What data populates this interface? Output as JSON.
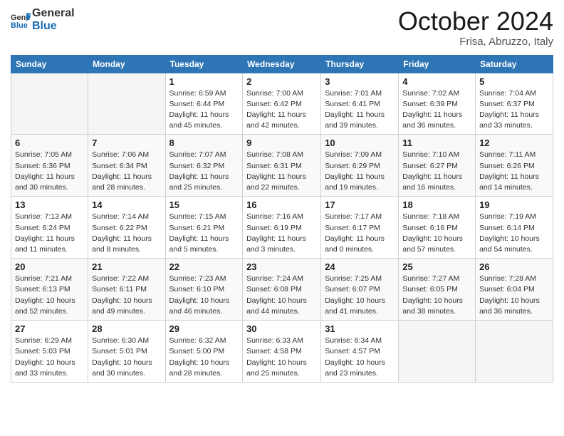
{
  "header": {
    "logo_general": "General",
    "logo_blue": "Blue",
    "month_title": "October 2024",
    "location": "Frisa, Abruzzo, Italy"
  },
  "weekdays": [
    "Sunday",
    "Monday",
    "Tuesday",
    "Wednesday",
    "Thursday",
    "Friday",
    "Saturday"
  ],
  "weeks": [
    [
      {
        "day": "",
        "sunrise": "",
        "sunset": "",
        "daylight": ""
      },
      {
        "day": "",
        "sunrise": "",
        "sunset": "",
        "daylight": ""
      },
      {
        "day": "1",
        "sunrise": "Sunrise: 6:59 AM",
        "sunset": "Sunset: 6:44 PM",
        "daylight": "Daylight: 11 hours and 45 minutes."
      },
      {
        "day": "2",
        "sunrise": "Sunrise: 7:00 AM",
        "sunset": "Sunset: 6:42 PM",
        "daylight": "Daylight: 11 hours and 42 minutes."
      },
      {
        "day": "3",
        "sunrise": "Sunrise: 7:01 AM",
        "sunset": "Sunset: 6:41 PM",
        "daylight": "Daylight: 11 hours and 39 minutes."
      },
      {
        "day": "4",
        "sunrise": "Sunrise: 7:02 AM",
        "sunset": "Sunset: 6:39 PM",
        "daylight": "Daylight: 11 hours and 36 minutes."
      },
      {
        "day": "5",
        "sunrise": "Sunrise: 7:04 AM",
        "sunset": "Sunset: 6:37 PM",
        "daylight": "Daylight: 11 hours and 33 minutes."
      }
    ],
    [
      {
        "day": "6",
        "sunrise": "Sunrise: 7:05 AM",
        "sunset": "Sunset: 6:36 PM",
        "daylight": "Daylight: 11 hours and 30 minutes."
      },
      {
        "day": "7",
        "sunrise": "Sunrise: 7:06 AM",
        "sunset": "Sunset: 6:34 PM",
        "daylight": "Daylight: 11 hours and 28 minutes."
      },
      {
        "day": "8",
        "sunrise": "Sunrise: 7:07 AM",
        "sunset": "Sunset: 6:32 PM",
        "daylight": "Daylight: 11 hours and 25 minutes."
      },
      {
        "day": "9",
        "sunrise": "Sunrise: 7:08 AM",
        "sunset": "Sunset: 6:31 PM",
        "daylight": "Daylight: 11 hours and 22 minutes."
      },
      {
        "day": "10",
        "sunrise": "Sunrise: 7:09 AM",
        "sunset": "Sunset: 6:29 PM",
        "daylight": "Daylight: 11 hours and 19 minutes."
      },
      {
        "day": "11",
        "sunrise": "Sunrise: 7:10 AM",
        "sunset": "Sunset: 6:27 PM",
        "daylight": "Daylight: 11 hours and 16 minutes."
      },
      {
        "day": "12",
        "sunrise": "Sunrise: 7:11 AM",
        "sunset": "Sunset: 6:26 PM",
        "daylight": "Daylight: 11 hours and 14 minutes."
      }
    ],
    [
      {
        "day": "13",
        "sunrise": "Sunrise: 7:13 AM",
        "sunset": "Sunset: 6:24 PM",
        "daylight": "Daylight: 11 hours and 11 minutes."
      },
      {
        "day": "14",
        "sunrise": "Sunrise: 7:14 AM",
        "sunset": "Sunset: 6:22 PM",
        "daylight": "Daylight: 11 hours and 8 minutes."
      },
      {
        "day": "15",
        "sunrise": "Sunrise: 7:15 AM",
        "sunset": "Sunset: 6:21 PM",
        "daylight": "Daylight: 11 hours and 5 minutes."
      },
      {
        "day": "16",
        "sunrise": "Sunrise: 7:16 AM",
        "sunset": "Sunset: 6:19 PM",
        "daylight": "Daylight: 11 hours and 3 minutes."
      },
      {
        "day": "17",
        "sunrise": "Sunrise: 7:17 AM",
        "sunset": "Sunset: 6:17 PM",
        "daylight": "Daylight: 11 hours and 0 minutes."
      },
      {
        "day": "18",
        "sunrise": "Sunrise: 7:18 AM",
        "sunset": "Sunset: 6:16 PM",
        "daylight": "Daylight: 10 hours and 57 minutes."
      },
      {
        "day": "19",
        "sunrise": "Sunrise: 7:19 AM",
        "sunset": "Sunset: 6:14 PM",
        "daylight": "Daylight: 10 hours and 54 minutes."
      }
    ],
    [
      {
        "day": "20",
        "sunrise": "Sunrise: 7:21 AM",
        "sunset": "Sunset: 6:13 PM",
        "daylight": "Daylight: 10 hours and 52 minutes."
      },
      {
        "day": "21",
        "sunrise": "Sunrise: 7:22 AM",
        "sunset": "Sunset: 6:11 PM",
        "daylight": "Daylight: 10 hours and 49 minutes."
      },
      {
        "day": "22",
        "sunrise": "Sunrise: 7:23 AM",
        "sunset": "Sunset: 6:10 PM",
        "daylight": "Daylight: 10 hours and 46 minutes."
      },
      {
        "day": "23",
        "sunrise": "Sunrise: 7:24 AM",
        "sunset": "Sunset: 6:08 PM",
        "daylight": "Daylight: 10 hours and 44 minutes."
      },
      {
        "day": "24",
        "sunrise": "Sunrise: 7:25 AM",
        "sunset": "Sunset: 6:07 PM",
        "daylight": "Daylight: 10 hours and 41 minutes."
      },
      {
        "day": "25",
        "sunrise": "Sunrise: 7:27 AM",
        "sunset": "Sunset: 6:05 PM",
        "daylight": "Daylight: 10 hours and 38 minutes."
      },
      {
        "day": "26",
        "sunrise": "Sunrise: 7:28 AM",
        "sunset": "Sunset: 6:04 PM",
        "daylight": "Daylight: 10 hours and 36 minutes."
      }
    ],
    [
      {
        "day": "27",
        "sunrise": "Sunrise: 6:29 AM",
        "sunset": "Sunset: 5:03 PM",
        "daylight": "Daylight: 10 hours and 33 minutes."
      },
      {
        "day": "28",
        "sunrise": "Sunrise: 6:30 AM",
        "sunset": "Sunset: 5:01 PM",
        "daylight": "Daylight: 10 hours and 30 minutes."
      },
      {
        "day": "29",
        "sunrise": "Sunrise: 6:32 AM",
        "sunset": "Sunset: 5:00 PM",
        "daylight": "Daylight: 10 hours and 28 minutes."
      },
      {
        "day": "30",
        "sunrise": "Sunrise: 6:33 AM",
        "sunset": "Sunset: 4:58 PM",
        "daylight": "Daylight: 10 hours and 25 minutes."
      },
      {
        "day": "31",
        "sunrise": "Sunrise: 6:34 AM",
        "sunset": "Sunset: 4:57 PM",
        "daylight": "Daylight: 10 hours and 23 minutes."
      },
      {
        "day": "",
        "sunrise": "",
        "sunset": "",
        "daylight": ""
      },
      {
        "day": "",
        "sunrise": "",
        "sunset": "",
        "daylight": ""
      }
    ]
  ]
}
